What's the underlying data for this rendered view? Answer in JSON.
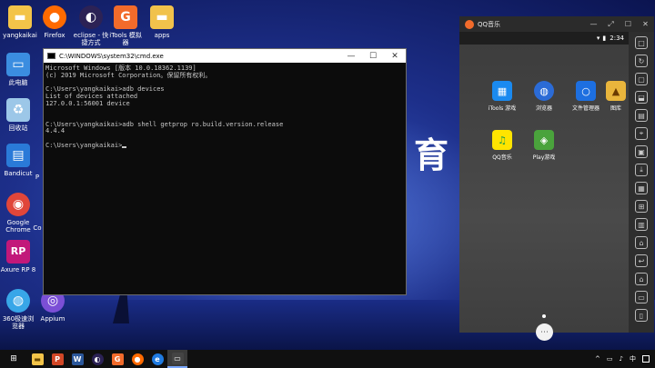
{
  "wallpaper": {
    "big_text": "育"
  },
  "desktop_icons": [
    {
      "label": "yangkaikai",
      "icon": "user-folder-icon",
      "color": "#f3c449"
    },
    {
      "label": "Firefox",
      "icon": "firefox-icon",
      "color": "#ff6a00"
    },
    {
      "label": "eclipse - 快捷方式",
      "icon": "eclipse-icon",
      "color": "#2c2255"
    },
    {
      "label": "iTools 模拟器",
      "icon": "itools-icon",
      "color": "#f26b2b"
    },
    {
      "label": "apps",
      "icon": "folder-icon",
      "color": "#f1c24b"
    },
    {
      "label": "此电脑",
      "icon": "computer-icon",
      "color": "#3b8de0"
    },
    {
      "label": "回收站",
      "icon": "recycle-bin-icon",
      "color": "#9cc7e8"
    },
    {
      "label": "Bandicut",
      "icon": "bandicut-icon",
      "color": "#2a7ad8"
    },
    {
      "label": "Google Chrome",
      "icon": "chrome-icon",
      "color": "#e0463a"
    },
    {
      "label": "Axure RP 8",
      "icon": "axure-icon",
      "color": "#c2187a"
    },
    {
      "label": "360极速浏览器",
      "icon": "browser-360-icon",
      "color": "#38a6e8"
    },
    {
      "label": "Appium",
      "icon": "appium-icon",
      "color": "#7b4fd6"
    },
    {
      "label": "Co",
      "icon": "app-icon",
      "color": "#5f6bd8"
    },
    {
      "label": "P",
      "icon": "app-icon",
      "color": "#5f6bd8"
    }
  ],
  "cmd": {
    "title": "C:\\WINDOWS\\system32\\cmd.exe",
    "lines": [
      "Microsoft Windows [版本 10.0.18362.1139]",
      "(c) 2019 Microsoft Corporation。保留所有权利。",
      "",
      "C:\\Users\\yangkaikai>adb devices",
      "List of devices attached",
      "127.0.0.1:56001 device",
      "",
      "",
      "C:\\Users\\yangkaikai>adb shell getprop ro.build.version.release",
      "4.4.4",
      "",
      "C:\\Users\\yangkaikai>"
    ],
    "minimize": "—",
    "maximize": "☐",
    "close": "✕"
  },
  "emulator": {
    "title": "QQ音乐",
    "time": "2:34",
    "minimize": "—",
    "maximize": "☐",
    "restore": "⤢",
    "close": "✕",
    "apps": [
      {
        "label": "iTools 游戏",
        "icon": "itools-games-icon",
        "color": "#1a8af0",
        "glyph": "▦"
      },
      {
        "label": "浏览器",
        "icon": "browser-icon",
        "color": "#2b6bd6",
        "glyph": "◍"
      },
      {
        "label": "文件管理器",
        "icon": "file-manager-icon",
        "color": "#1d6fe0",
        "glyph": "○"
      },
      {
        "label": "图库",
        "icon": "gallery-icon",
        "color": "#e9b53c",
        "glyph": "▲"
      },
      {
        "label": "QQ音乐",
        "icon": "qq-music-icon",
        "color": "#ffe400",
        "glyph": "♫"
      },
      {
        "label": "Play游戏",
        "icon": "play-games-icon",
        "color": "#4aa33c",
        "glyph": "◈"
      }
    ],
    "drawer_glyph": "⋯",
    "side_buttons": [
      "□",
      "↻",
      "▢",
      "⬓",
      "▤",
      "⌖",
      "▣",
      "⤓",
      "▦",
      "⊞",
      "▥",
      "⌂",
      "↩",
      "⌂",
      "▭",
      "▯"
    ]
  },
  "taskbar": {
    "items": [
      {
        "icon": "windows-start-icon",
        "glyph": "⊞",
        "color": "#ffffff"
      },
      {
        "icon": "file-explorer-icon",
        "glyph": "▬",
        "color": "#f3c449"
      },
      {
        "icon": "powerpoint-icon",
        "glyph": "P",
        "color": "#d24726"
      },
      {
        "icon": "word-icon",
        "glyph": "W",
        "color": "#2b579a"
      },
      {
        "icon": "eclipse-icon",
        "glyph": "◐",
        "color": "#2c2255"
      },
      {
        "icon": "itools-icon",
        "glyph": "G",
        "color": "#f26b2b"
      },
      {
        "icon": "firefox-icon",
        "glyph": "●",
        "color": "#ff6a00"
      },
      {
        "icon": "edge-icon",
        "glyph": "e",
        "color": "#1f7ae0"
      },
      {
        "icon": "cmd-icon",
        "glyph": "▭",
        "color": "#444444",
        "active": true
      }
    ],
    "tray": [
      "^",
      "▭",
      "♪",
      "中"
    ]
  }
}
